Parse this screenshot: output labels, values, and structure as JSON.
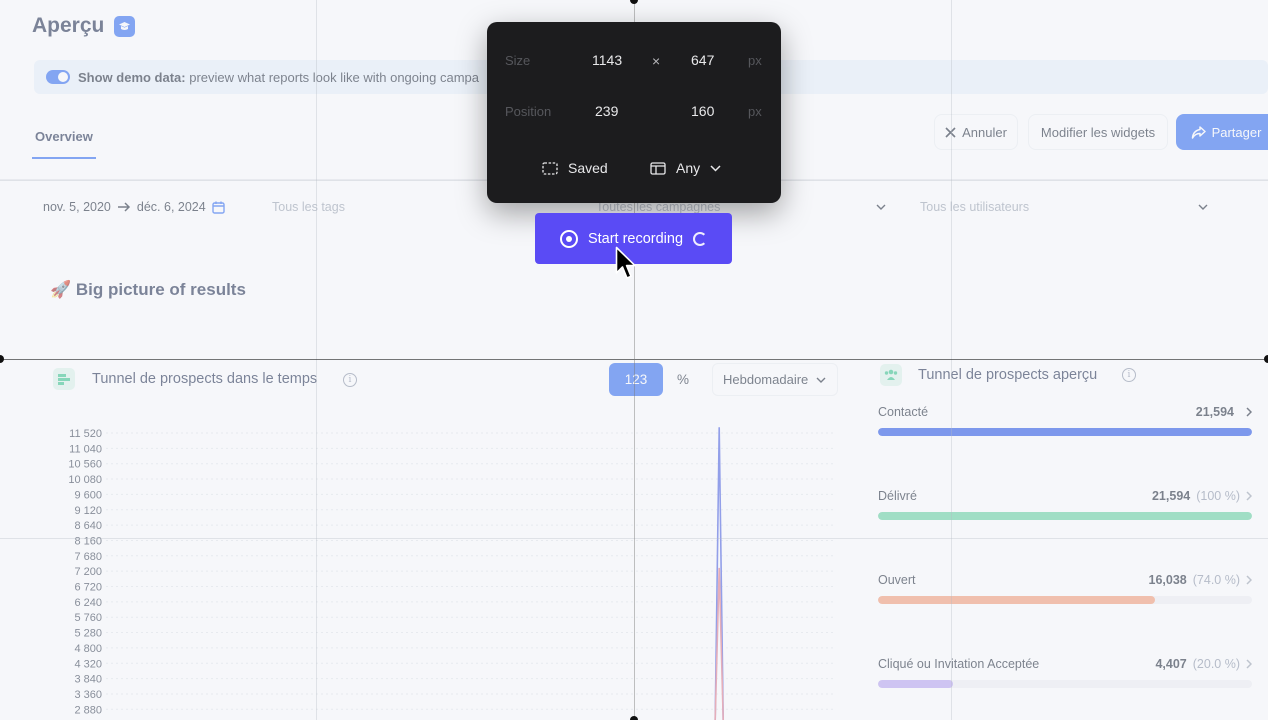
{
  "page": {
    "title": "Aperçu",
    "banner": {
      "bold": "Show demo data:",
      "text": " preview what reports look like with ongoing campa"
    },
    "tabs": [
      {
        "label": "Overview",
        "active": true
      }
    ],
    "actions": {
      "cancel": "Annuler",
      "edit_widgets": "Modifier les widgets",
      "share": "Partager"
    },
    "filters": {
      "date_start": "nov. 5, 2020",
      "date_end": "déc. 6, 2024",
      "tags_placeholder": "Tous les tags",
      "campaigns_placeholder": "Toutes les campagnes",
      "users_placeholder": "Tous les utilisateurs"
    },
    "section_title": "🚀 Big picture of results"
  },
  "funnel_chart": {
    "title": "Tunnel de prospects dans le temps",
    "toggle_count": "123",
    "toggle_percent": "%",
    "granularity": "Hebdomadaire"
  },
  "chart_data": {
    "type": "line",
    "title": "Tunnel de prospects dans le temps",
    "xlabel": "",
    "ylabel": "",
    "y_ticks": [
      11520,
      11040,
      10560,
      10080,
      9600,
      9120,
      8640,
      8160,
      7680,
      7200,
      6720,
      6240,
      5760,
      5280,
      4800,
      4320,
      3840,
      3360,
      2880
    ],
    "ylim": [
      2880,
      11520
    ],
    "grid": true,
    "series": [
      {
        "color": "#4a5fe0",
        "peak_x_fraction": 0.84,
        "peak_value": 11700
      },
      {
        "color": "#e07a8a",
        "peak_x_fraction": 0.84,
        "peak_value": 7300
      }
    ]
  },
  "funnel_overview": {
    "title": "Tunnel de prospects aperçu",
    "items": [
      {
        "label": "Contacté",
        "value": "21,594",
        "pct": "",
        "fraction": 1.0,
        "color": "#2453e6"
      },
      {
        "label": "Délivré",
        "value": "21,594",
        "pct": "(100 %)",
        "fraction": 1.0,
        "color": "#63d19e"
      },
      {
        "label": "Ouvert",
        "value": "16,038",
        "pct": "(74.0 %)",
        "fraction": 0.74,
        "color": "#f49a73"
      },
      {
        "label": "Cliqué ou Invitation Acceptée",
        "value": "4,407",
        "pct": "(20.0 %)",
        "fraction": 0.2,
        "color": "#b7a3f0"
      }
    ]
  },
  "capture": {
    "size_label": "Size",
    "width": "1143",
    "times": "×",
    "height": "647",
    "position_label": "Position",
    "pos_x": "239",
    "pos_y": "160",
    "unit": "px",
    "saved_label": "Saved",
    "any_label": "Any",
    "record_label": "Start recording"
  }
}
